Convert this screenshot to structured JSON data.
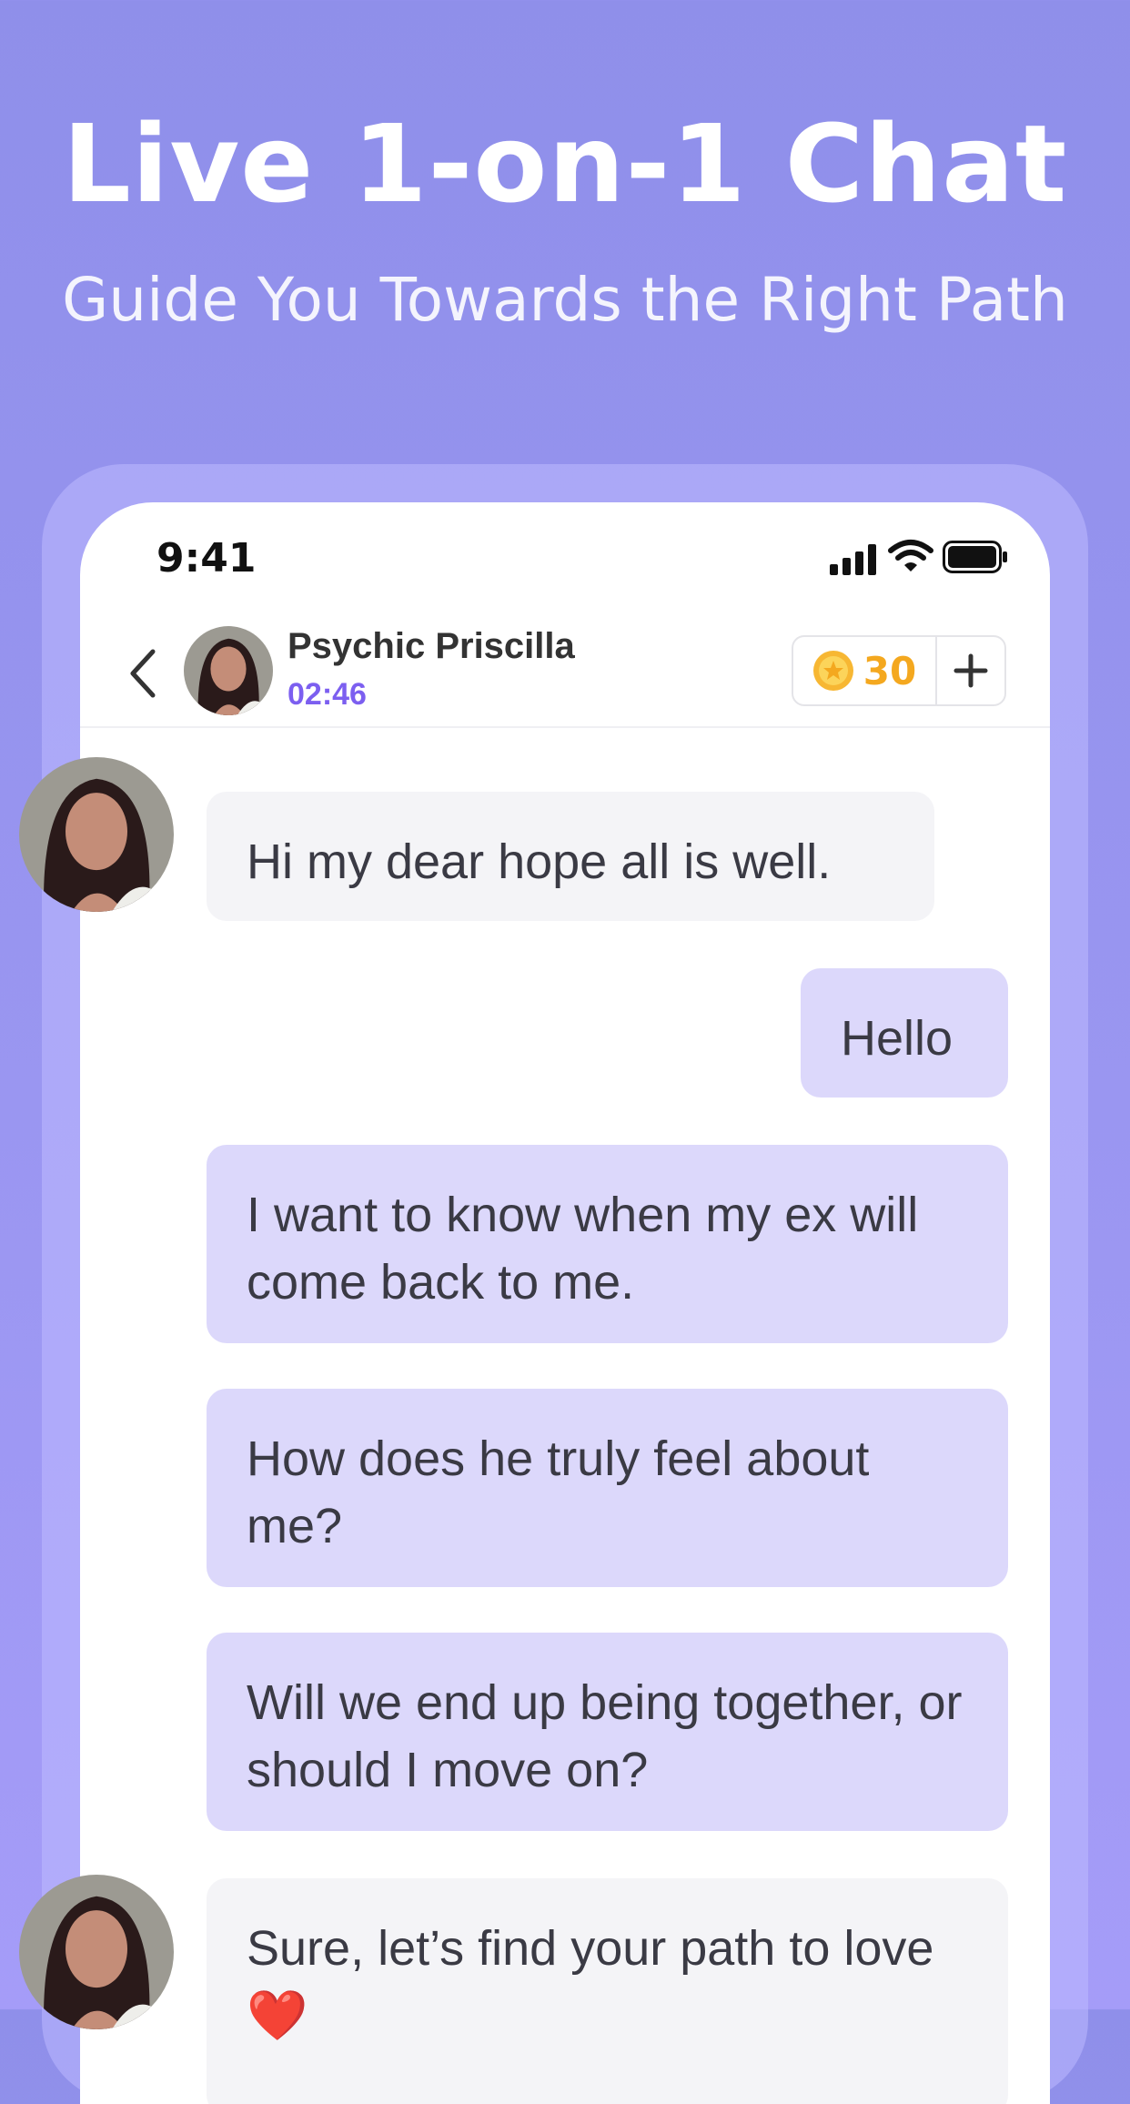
{
  "promo": {
    "title": "Live 1-on-1 Chat",
    "subtitle": "Guide You Towards the Right Path"
  },
  "status_bar": {
    "time": "9:41"
  },
  "chat_header": {
    "advisor_name": "Psychic Priscilla",
    "timer": "02:46",
    "coin_balance": "30",
    "add_coins_label": "+"
  },
  "messages": [
    {
      "sender": "advisor",
      "text": "Hi my dear hope all is well."
    },
    {
      "sender": "user",
      "text": "Hello"
    },
    {
      "sender": "user",
      "text": "I want to know when my ex will come back to me."
    },
    {
      "sender": "user",
      "text": "How does he truly feel about me?"
    },
    {
      "sender": "user",
      "text": "Will we end up being together, or should I move on?"
    },
    {
      "sender": "advisor",
      "text": "Sure, let’s find your path to love ❤️"
    }
  ],
  "colors": {
    "background": "#9a96f1",
    "accent": "#7c5ff0",
    "coin": "#f4a81f",
    "incoming_bubble": "#f4f4f7",
    "outgoing_bubble": "#dcd8fb"
  },
  "icons": [
    "back-icon",
    "signal-icon",
    "wifi-icon",
    "battery-icon",
    "coin-icon",
    "plus-icon"
  ]
}
